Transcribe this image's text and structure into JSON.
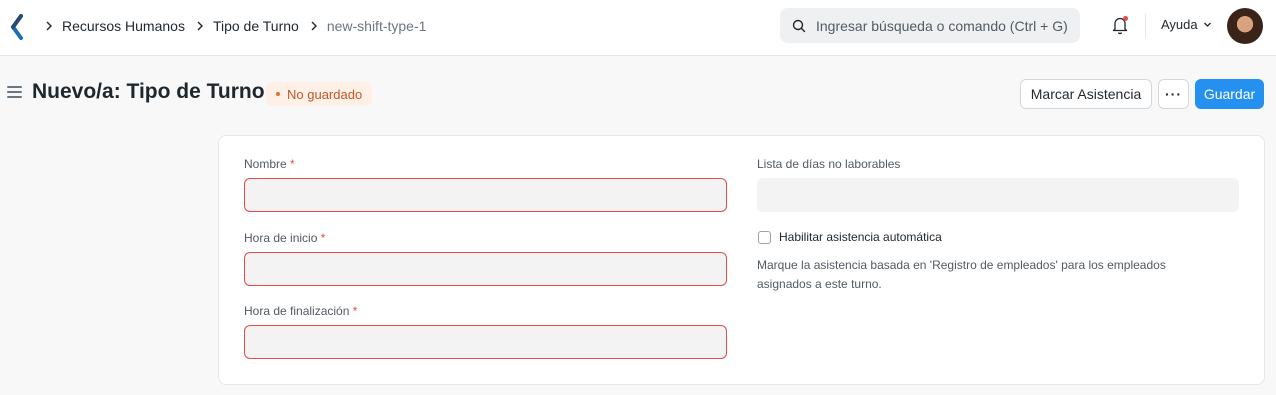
{
  "navbar": {
    "breadcrumbs": [
      "Recursos Humanos",
      "Tipo de Turno"
    ],
    "current": "new-shift-type-1",
    "search_placeholder": "Ingresar búsqueda o comando (Ctrl + G)",
    "help_label": "Ayuda",
    "icons": [
      "app-logo-icon",
      "chevron-right-icon",
      "search-icon",
      "bell-icon",
      "chevron-down-icon"
    ]
  },
  "page": {
    "title": "Nuevo/a: Tipo de Turno",
    "status": "No guardado",
    "actions": {
      "attendance_label": "Marcar Asistencia",
      "more_label": "···",
      "save_label": "Guardar"
    }
  },
  "form": {
    "name_label": "Nombre",
    "start_label": "Hora de inicio",
    "end_label": "Hora de finalización",
    "required_mark": "*",
    "holiday_label": "Lista de días no laborables",
    "auto_attendance_label": "Habilitar asistencia automática",
    "auto_attendance_help": "Marque la asistencia basada en 'Registro de empleados' para los empleados asignados a este turno."
  },
  "colors": {
    "primary": "#2490ef",
    "required": "#e24c4c",
    "badge_bg": "#fff0e7",
    "badge_text": "#c0582a"
  }
}
